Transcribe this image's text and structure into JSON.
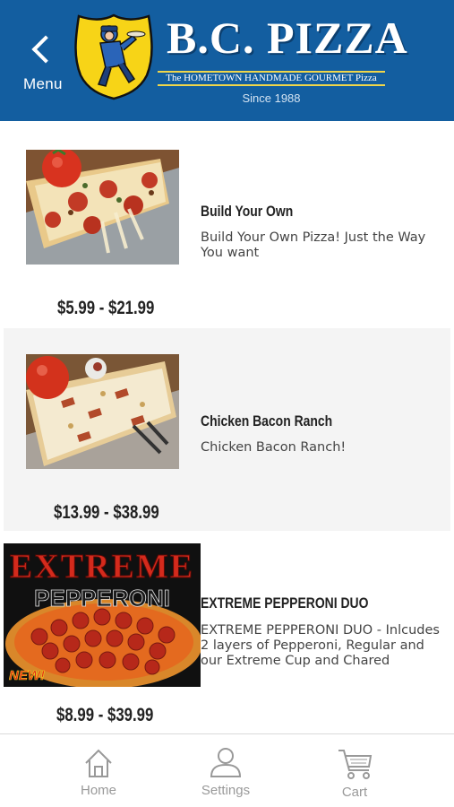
{
  "header": {
    "back_label": "Menu",
    "brand_name": "B.C. PIZZA",
    "tagline": "The HOMETOWN HANDMADE GOURMET Pizza",
    "since": "Since 1988",
    "background_color": "#135ea0"
  },
  "items": [
    {
      "title": "Build Your Own",
      "description": "Build Your Own Pizza! Just the Way You want",
      "price": "$5.99 - $21.99",
      "image": "pizza-slice-photo"
    },
    {
      "title": "Chicken Bacon Ranch",
      "description": "Chicken Bacon Ranch!",
      "price": "$13.99 - $38.99",
      "image": "chicken-bacon-ranch-photo"
    },
    {
      "title": "EXTREME PEPPERONI  DUO",
      "description": "EXTREME PEPPERONI  DUO - Inlcudes 2 layers of Pepperoni, Regular and our Extreme Cup and Chared",
      "price": "$8.99 - $39.99",
      "image": "extreme-pepperoni-photo",
      "banner_line1": "EXTREME",
      "banner_line2": "PEPPERONI",
      "badge": "NEW!"
    }
  ],
  "tabs": [
    {
      "label": "Home",
      "icon": "home-icon"
    },
    {
      "label": "Settings",
      "icon": "person-icon"
    },
    {
      "label": "Cart",
      "icon": "cart-icon"
    }
  ]
}
